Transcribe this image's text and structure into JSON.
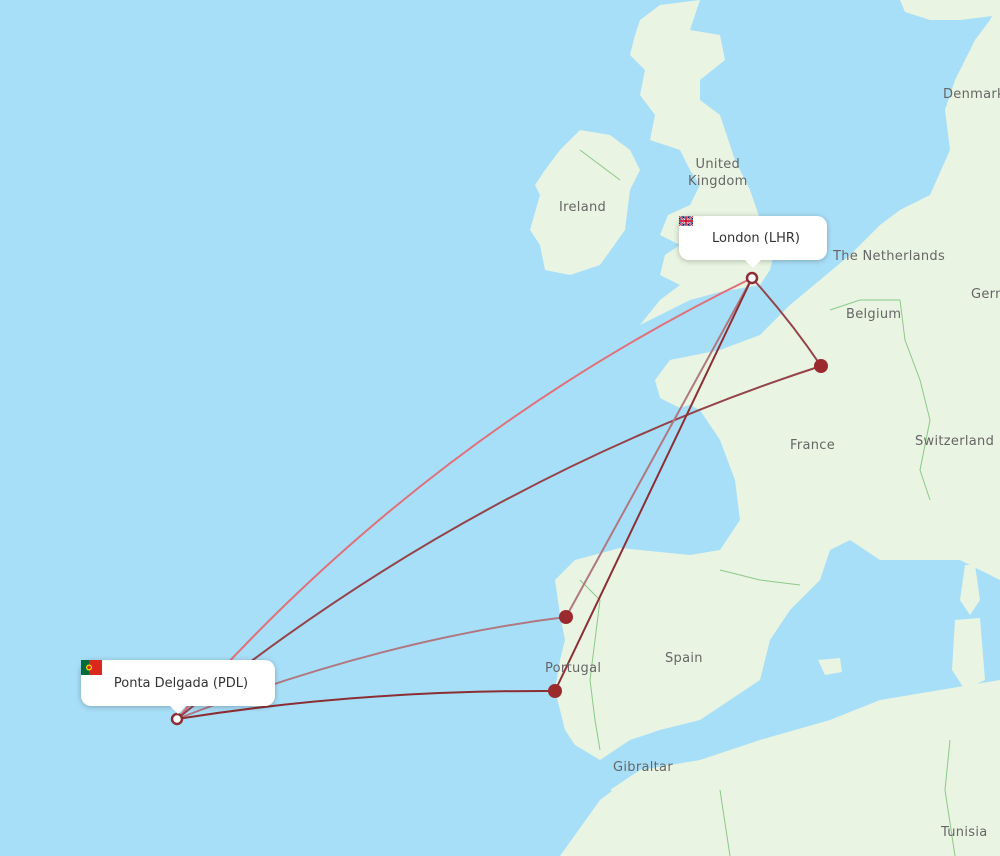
{
  "map": {
    "origin": {
      "city": "Ponta Delgada",
      "code": "PDL",
      "label": "Ponta Delgada (PDL)",
      "flag": "portugal-flag"
    },
    "destination": {
      "city": "London",
      "code": "LHR",
      "label": "London (LHR)",
      "flag": "united-kingdom-flag"
    },
    "country_labels": [
      {
        "name": "Ireland"
      },
      {
        "name": "United\nKingdom"
      },
      {
        "name": "Denmark"
      },
      {
        "name": "The Netherlands"
      },
      {
        "name": "Germany"
      },
      {
        "name": "Belgium"
      },
      {
        "name": "France"
      },
      {
        "name": "Switzerland"
      },
      {
        "name": "Portugal"
      },
      {
        "name": "Spain"
      },
      {
        "name": "Gibraltar"
      },
      {
        "name": "Tunisia"
      }
    ],
    "colors": {
      "water": "#a8dff8",
      "land": "#e9f4e2",
      "route_dark": "#8b2f35",
      "route_light": "#e0707a",
      "route_muted": "#a86a72",
      "stop_fill": "#9b2a2e",
      "border": "#8cc98a"
    },
    "routes": [
      {
        "name": "PDL-LHR direct",
        "style": "light"
      },
      {
        "name": "PDL-Paris-LHR",
        "style": "dark"
      },
      {
        "name": "PDL-Porto-LHR",
        "style": "muted"
      },
      {
        "name": "PDL-Lisbon-LHR",
        "style": "dark"
      }
    ],
    "stops": [
      {
        "name": "Paris"
      },
      {
        "name": "Porto"
      },
      {
        "name": "Lisbon"
      }
    ]
  }
}
